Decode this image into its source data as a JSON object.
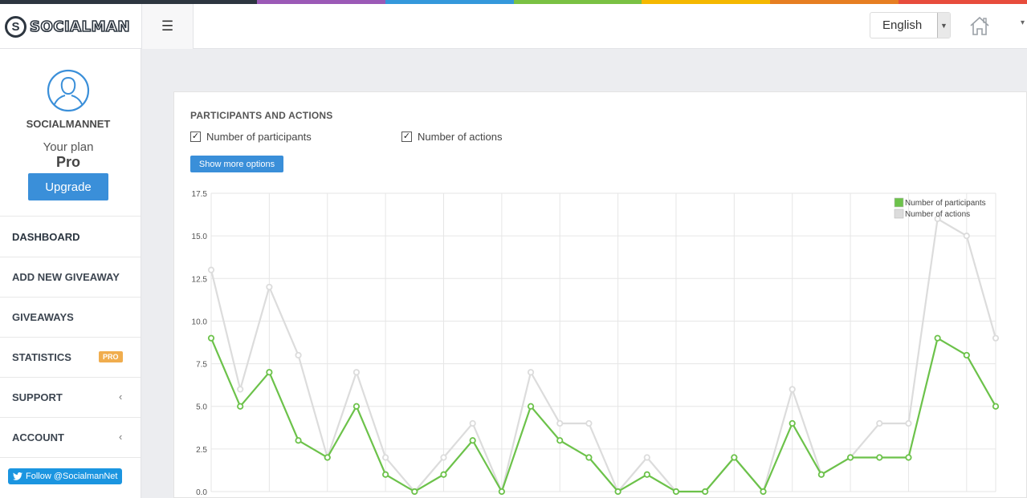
{
  "brand": {
    "logo_letter": "S",
    "name": "SOCIALMAN"
  },
  "topbar": {
    "menu_icon": "hamburger-icon",
    "language": "English",
    "home_icon": "home-icon"
  },
  "rainbow_colors": [
    "#2d3640",
    "#2d3640",
    "#9b59b6",
    "#3498db",
    "#7ac143",
    "#f5b800",
    "#e67e22",
    "#e74c3c"
  ],
  "profile": {
    "username": "SOCIALMANNET",
    "plan_label": "Your plan",
    "plan_name": "Pro",
    "upgrade_label": "Upgrade"
  },
  "nav": {
    "dashboard": "DASHBOARD",
    "add_giveaway": "ADD NEW GIVEAWAY",
    "giveaways": "GIVEAWAYS",
    "statistics": "STATISTICS",
    "statistics_badge": "PRO",
    "support": "SUPPORT",
    "account": "ACCOUNT"
  },
  "twitter": {
    "label": "Follow @SocialmanNet"
  },
  "card": {
    "title": "PARTICIPANTS AND ACTIONS",
    "checkbox_participants": "Number of participants",
    "checkbox_actions": "Number of actions",
    "more_options": "Show more options"
  },
  "chart_data": {
    "type": "line",
    "title": "",
    "xlabel": "",
    "ylabel": "",
    "ylim": [
      0,
      17.5
    ],
    "yticks": [
      "0.0",
      "2.5",
      "5.0",
      "7.5",
      "10.0",
      "12.5",
      "15.0",
      "17.5"
    ],
    "legend_position": "top-right",
    "grid": true,
    "series": [
      {
        "name": "Number of participants",
        "color": "#6cc24a",
        "values": [
          9,
          5,
          7,
          3,
          2,
          5,
          1,
          0,
          1,
          3,
          0,
          5,
          3,
          2,
          0,
          1,
          0,
          0,
          2,
          0,
          4,
          1,
          2,
          2,
          2,
          9,
          8,
          5
        ]
      },
      {
        "name": "Number of actions",
        "color": "#dcdcdc",
        "values": [
          13,
          6,
          12,
          8,
          2,
          7,
          2,
          0,
          2,
          4,
          0,
          7,
          4,
          4,
          0,
          2,
          0,
          0,
          2,
          0,
          6,
          1,
          2,
          4,
          4,
          16,
          15,
          9
        ]
      }
    ]
  }
}
